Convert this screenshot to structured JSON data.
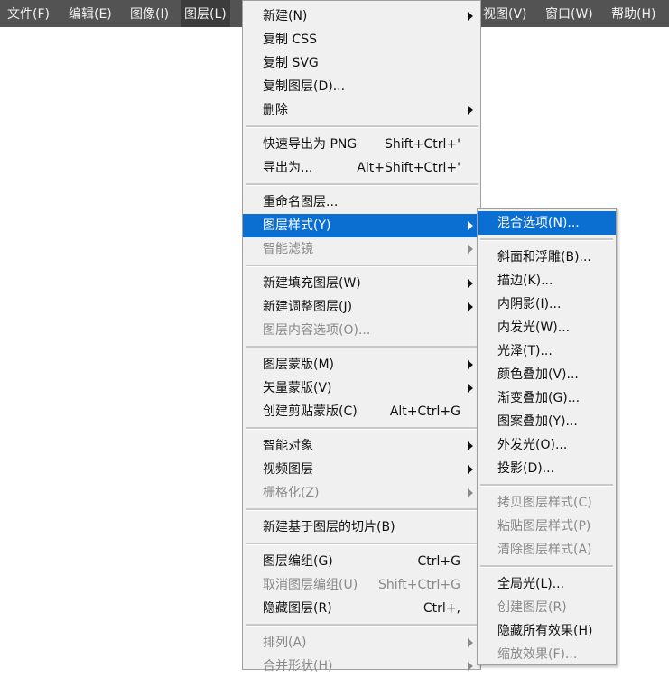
{
  "menubar": [
    {
      "label": "文件(F)",
      "left": "file"
    },
    {
      "label": "编辑(E)"
    },
    {
      "label": "图像(I)"
    },
    {
      "label": "图层(L)",
      "active": true
    },
    {
      "label": "视图(V)"
    },
    {
      "label": "窗口(W)"
    },
    {
      "label": "帮助(H)"
    }
  ],
  "layer_menu": [
    {
      "label": "新建(N)",
      "submenu": true
    },
    {
      "label": "复制 CSS"
    },
    {
      "label": "复制 SVG"
    },
    {
      "label": "复制图层(D)..."
    },
    {
      "label": "删除",
      "submenu": true
    },
    {
      "sep": true
    },
    {
      "label": "快速导出为 PNG",
      "shortcut": "Shift+Ctrl+'"
    },
    {
      "label": "导出为...",
      "shortcut": "Alt+Shift+Ctrl+'"
    },
    {
      "sep": true
    },
    {
      "label": "重命名图层..."
    },
    {
      "label": "图层样式(Y)",
      "submenu": true,
      "highlighted": true
    },
    {
      "label": "智能滤镜",
      "submenu": true,
      "disabled": true
    },
    {
      "sep": true
    },
    {
      "label": "新建填充图层(W)",
      "submenu": true
    },
    {
      "label": "新建调整图层(J)",
      "submenu": true
    },
    {
      "label": "图层内容选项(O)...",
      "disabled": true
    },
    {
      "sep": true
    },
    {
      "label": "图层蒙版(M)",
      "submenu": true
    },
    {
      "label": "矢量蒙版(V)",
      "submenu": true
    },
    {
      "label": "创建剪贴蒙版(C)",
      "shortcut": "Alt+Ctrl+G"
    },
    {
      "sep": true
    },
    {
      "label": "智能对象",
      "submenu": true
    },
    {
      "label": "视频图层",
      "submenu": true
    },
    {
      "label": "栅格化(Z)",
      "submenu": true,
      "disabled": true
    },
    {
      "sep": true
    },
    {
      "label": "新建基于图层的切片(B)"
    },
    {
      "sep": true
    },
    {
      "label": "图层编组(G)",
      "shortcut": "Ctrl+G"
    },
    {
      "label": "取消图层编组(U)",
      "shortcut": "Shift+Ctrl+G",
      "disabled": true
    },
    {
      "label": "隐藏图层(R)",
      "shortcut": "Ctrl+,"
    },
    {
      "sep": true
    },
    {
      "label": "排列(A)",
      "submenu": true,
      "disabled": true
    },
    {
      "label": "合并形状(H)",
      "submenu": true,
      "disabled": true
    }
  ],
  "layer_style_submenu": [
    {
      "label": "混合选项(N)...",
      "highlighted": true
    },
    {
      "sep": true
    },
    {
      "label": "斜面和浮雕(B)..."
    },
    {
      "label": "描边(K)..."
    },
    {
      "label": "内阴影(I)..."
    },
    {
      "label": "内发光(W)..."
    },
    {
      "label": "光泽(T)..."
    },
    {
      "label": "颜色叠加(V)..."
    },
    {
      "label": "渐变叠加(G)..."
    },
    {
      "label": "图案叠加(Y)..."
    },
    {
      "label": "外发光(O)..."
    },
    {
      "label": "投影(D)..."
    },
    {
      "sep": true
    },
    {
      "label": "拷贝图层样式(C)",
      "disabled": true
    },
    {
      "label": "粘贴图层样式(P)",
      "disabled": true
    },
    {
      "label": "清除图层样式(A)",
      "disabled": true
    },
    {
      "sep": true
    },
    {
      "label": "全局光(L)..."
    },
    {
      "label": "创建图层(R)",
      "disabled": true
    },
    {
      "label": "隐藏所有效果(H)"
    },
    {
      "label": "缩放效果(F)...",
      "disabled": true
    }
  ]
}
